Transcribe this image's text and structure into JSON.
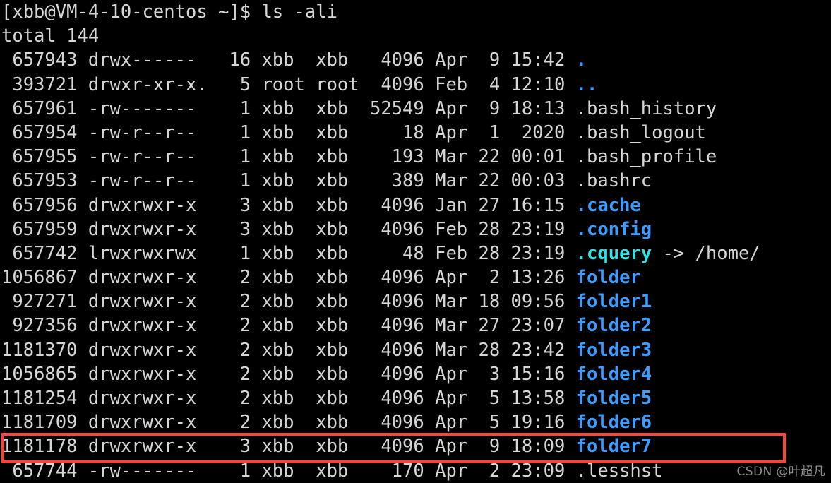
{
  "terminal": {
    "background_color": "#000000",
    "foreground_color": "#d6d6d6",
    "dir_color": "#3b9dff",
    "link_color": "#32e2e2",
    "prompt": "[xbb@VM-4-10-centos ~]$ ls -ali",
    "total_line": "total 144",
    "rows": [
      {
        "inode": " 657943",
        "perms": "drwx------",
        "links": "16",
        "owner": "xbb",
        "group": "xbb",
        "size": " 4096",
        "month": "Apr",
        "day": " 9",
        "time": "15:42",
        "name": ".",
        "name_class": "c-dir",
        "suffix": ""
      },
      {
        "inode": " 393721",
        "perms": "drwxr-xr-x.",
        "links": " 5",
        "owner": "root",
        "group": "root",
        "size": " 4096",
        "month": "Feb",
        "day": " 4",
        "time": "12:10",
        "name": "..",
        "name_class": "c-dir",
        "suffix": ""
      },
      {
        "inode": " 657961",
        "perms": "-rw-------",
        "links": " 1",
        "owner": "xbb",
        "group": "xbb",
        "size": "52549",
        "month": "Apr",
        "day": " 9",
        "time": "18:13",
        "name": ".bash_history",
        "name_class": "c-default",
        "suffix": ""
      },
      {
        "inode": " 657954",
        "perms": "-rw-r--r--",
        "links": " 1",
        "owner": "xbb",
        "group": "xbb",
        "size": "   18",
        "month": "Apr",
        "day": " 1",
        "time": " 2020",
        "name": ".bash_logout",
        "name_class": "c-default",
        "suffix": ""
      },
      {
        "inode": " 657955",
        "perms": "-rw-r--r--",
        "links": " 1",
        "owner": "xbb",
        "group": "xbb",
        "size": "  193",
        "month": "Mar",
        "day": "22",
        "time": "00:01",
        "name": ".bash_profile",
        "name_class": "c-default",
        "suffix": ""
      },
      {
        "inode": " 657953",
        "perms": "-rw-r--r--",
        "links": " 1",
        "owner": "xbb",
        "group": "xbb",
        "size": "  389",
        "month": "Mar",
        "day": "22",
        "time": "00:03",
        "name": ".bashrc",
        "name_class": "c-default",
        "suffix": ""
      },
      {
        "inode": " 657956",
        "perms": "drwxrwxr-x",
        "links": " 3",
        "owner": "xbb",
        "group": "xbb",
        "size": " 4096",
        "month": "Jan",
        "day": "27",
        "time": "16:15",
        "name": ".cache",
        "name_class": "c-dir",
        "suffix": ""
      },
      {
        "inode": " 657959",
        "perms": "drwxrwxr-x",
        "links": " 3",
        "owner": "xbb",
        "group": "xbb",
        "size": " 4096",
        "month": "Feb",
        "day": "28",
        "time": "23:19",
        "name": ".config",
        "name_class": "c-dir",
        "suffix": ""
      },
      {
        "inode": " 657742",
        "perms": "lrwxrwxrwx",
        "links": " 1",
        "owner": "xbb",
        "group": "xbb",
        "size": "   48",
        "month": "Feb",
        "day": "28",
        "time": "23:19",
        "name": ".cquery",
        "name_class": "c-link",
        "suffix": " -> /home/"
      },
      {
        "inode": "1056867",
        "perms": "drwxrwxr-x",
        "links": " 2",
        "owner": "xbb",
        "group": "xbb",
        "size": " 4096",
        "month": "Apr",
        "day": " 2",
        "time": "13:26",
        "name": "folder",
        "name_class": "c-dir",
        "suffix": ""
      },
      {
        "inode": " 927271",
        "perms": "drwxrwxr-x",
        "links": " 2",
        "owner": "xbb",
        "group": "xbb",
        "size": " 4096",
        "month": "Mar",
        "day": "18",
        "time": "09:56",
        "name": "folder1",
        "name_class": "c-dir",
        "suffix": ""
      },
      {
        "inode": " 927356",
        "perms": "drwxrwxr-x",
        "links": " 2",
        "owner": "xbb",
        "group": "xbb",
        "size": " 4096",
        "month": "Mar",
        "day": "27",
        "time": "23:07",
        "name": "folder2",
        "name_class": "c-dir",
        "suffix": ""
      },
      {
        "inode": "1181370",
        "perms": "drwxrwxr-x",
        "links": " 2",
        "owner": "xbb",
        "group": "xbb",
        "size": " 4096",
        "month": "Mar",
        "day": "28",
        "time": "23:42",
        "name": "folder3",
        "name_class": "c-dir",
        "suffix": ""
      },
      {
        "inode": "1056865",
        "perms": "drwxrwxr-x",
        "links": " 2",
        "owner": "xbb",
        "group": "xbb",
        "size": " 4096",
        "month": "Apr",
        "day": " 3",
        "time": "15:16",
        "name": "folder4",
        "name_class": "c-dir",
        "suffix": ""
      },
      {
        "inode": "1181254",
        "perms": "drwxrwxr-x",
        "links": " 2",
        "owner": "xbb",
        "group": "xbb",
        "size": " 4096",
        "month": "Apr",
        "day": " 5",
        "time": "13:58",
        "name": "folder5",
        "name_class": "c-dir",
        "suffix": ""
      },
      {
        "inode": "1181709",
        "perms": "drwxrwxr-x",
        "links": " 2",
        "owner": "xbb",
        "group": "xbb",
        "size": " 4096",
        "month": "Apr",
        "day": " 5",
        "time": "19:16",
        "name": "folder6",
        "name_class": "c-dir",
        "suffix": ""
      },
      {
        "inode": "1181178",
        "perms": "drwxrwxr-x",
        "links": " 3",
        "owner": "xbb",
        "group": "xbb",
        "size": " 4096",
        "month": "Apr",
        "day": " 9",
        "time": "18:09",
        "name": "folder7",
        "name_class": "c-dir",
        "suffix": ""
      },
      {
        "inode": " 657744",
        "perms": "-rw-------",
        "links": " 1",
        "owner": "xbb",
        "group": "xbb",
        "size": "  170",
        "month": "Apr",
        "day": " 2",
        "time": "23:09",
        "name": ".lesshst",
        "name_class": "c-default",
        "suffix": ""
      }
    ]
  },
  "annotation": {
    "highlight_color": "#f9443c",
    "highlighted_row_index": 16
  },
  "watermark": {
    "text": "CSDN @叶超凡",
    "color": "#8d8d8d"
  }
}
